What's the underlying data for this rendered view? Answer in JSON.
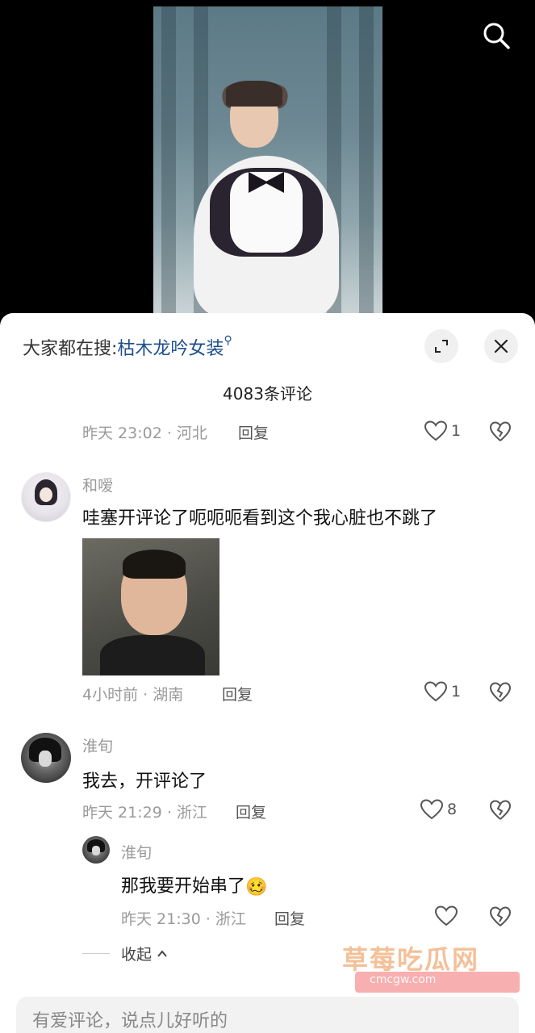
{
  "hot_search": {
    "prefix": "大家都在搜:",
    "keyword": "枯木龙吟女装"
  },
  "comment_count": "4083条评论",
  "comments": [
    {
      "meta": "昨天 23:02 · 河北",
      "reply_label": "回复",
      "likes": "1"
    },
    {
      "username": "和嗳",
      "text": "哇塞开评论了呃呃呃看到这个我心脏也不跳了",
      "has_image": true,
      "meta": "4小时前 · 湖南",
      "reply_label": "回复",
      "likes": "1"
    },
    {
      "username": "淮旬",
      "text": "我去，开评论了",
      "meta": "昨天 21:29 · 浙江",
      "reply_label": "回复",
      "likes": "8",
      "replies": [
        {
          "username": "淮旬",
          "text": "那我要开始串了",
          "emoji": "🥴",
          "meta": "昨天 21:30 · 浙江",
          "reply_label": "回复",
          "likes": ""
        }
      ]
    }
  ],
  "collapse_label": "收起",
  "watermark": {
    "text": "草莓吃瓜网",
    "sub": "cmcgw.com"
  },
  "input": {
    "placeholder": "有爱评论，说点儿好听的"
  },
  "colors": {
    "keyword_blue": "#1e4f8c",
    "meta_gray": "#9a9a9a"
  },
  "icons": [
    "search-icon",
    "expand-icon",
    "close-icon",
    "heart-icon",
    "broken-heart-icon",
    "chevron-up-icon",
    "search-mini-icon"
  ]
}
